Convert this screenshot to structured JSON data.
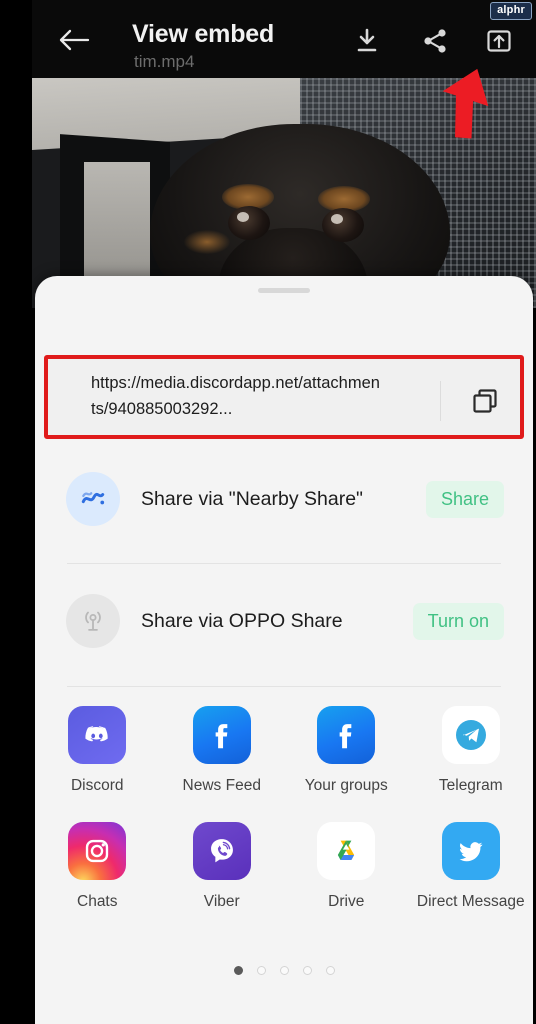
{
  "watermark": {
    "text": "alphr"
  },
  "appbar": {
    "title": "View embed",
    "subtitle": "tim.mp4",
    "back_label": "Back",
    "actions": [
      {
        "name": "download",
        "label": "Download"
      },
      {
        "name": "share",
        "label": "Share"
      },
      {
        "name": "open-external",
        "label": "Open externally"
      }
    ]
  },
  "photo": {
    "alt": "Close-up photo of a black and tan dog in front of a mesh chair"
  },
  "annotation": {
    "type": "red-arrow",
    "points_to": "share-icon"
  },
  "sheet": {
    "url": "https://media.discordapp.net/attachments/940885003292...",
    "copy_icon_label": "Copy",
    "rows": [
      {
        "label": "Share via \"Nearby Share\"",
        "action": "Share",
        "icon": "nearby-share-icon"
      },
      {
        "label": "Share via OPPO Share",
        "action": "Turn on",
        "icon": "oppo-share-icon"
      }
    ],
    "apps": [
      {
        "name": "Discord",
        "icon": "discord-icon"
      },
      {
        "name": "News Feed",
        "icon": "facebook-icon"
      },
      {
        "name": "Your groups",
        "icon": "facebook-icon"
      },
      {
        "name": "Telegram",
        "icon": "telegram-icon"
      },
      {
        "name": "Chats",
        "icon": "instagram-icon"
      },
      {
        "name": "Viber",
        "icon": "viber-icon"
      },
      {
        "name": "Drive",
        "icon": "google-drive-icon"
      },
      {
        "name": "Direct Message",
        "icon": "twitter-icon"
      }
    ],
    "pages": {
      "count": 5,
      "active": 1
    }
  },
  "colors": {
    "appbar_bg": "#0a0a0a",
    "sheet_bg": "#f4f4f4",
    "highlight_red": "#e01b1b",
    "action_green_text": "#41c184",
    "action_green_bg": "#e2f6ea"
  }
}
